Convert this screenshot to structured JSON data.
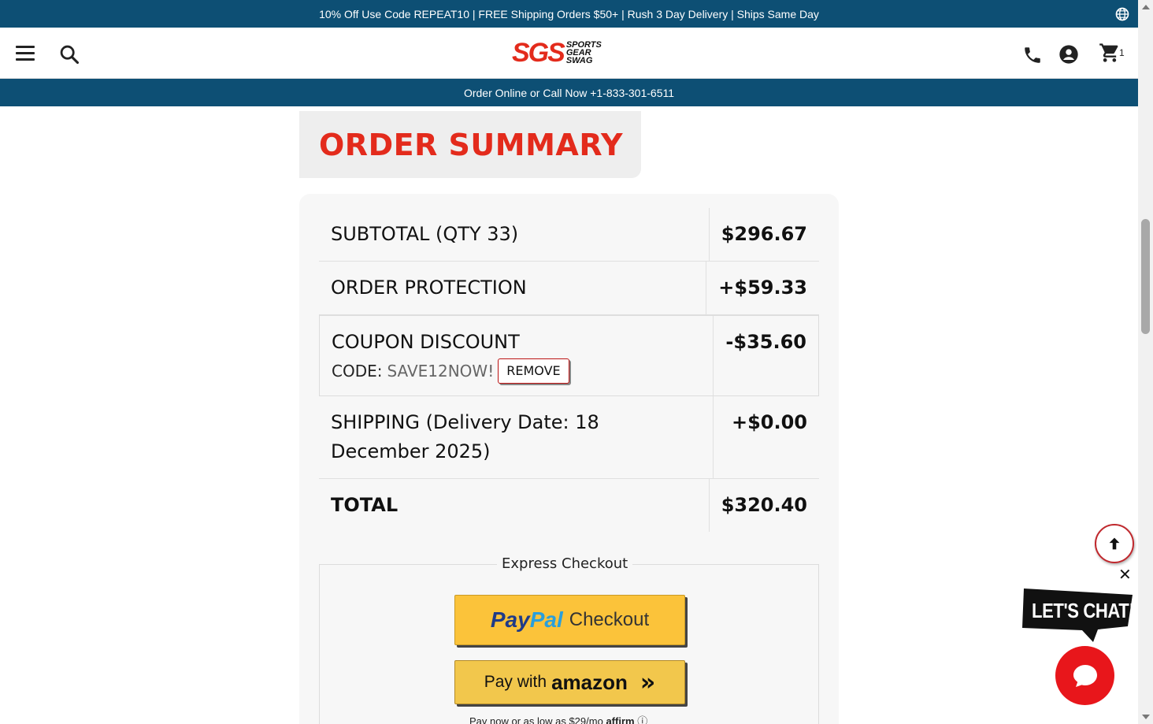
{
  "promo": {
    "text": "10% Off Use Code REPEAT10 | FREE Shipping Orders $50+ | Rush 3 Day Delivery | Ships Same Day"
  },
  "header": {
    "logo_mark": "SGS",
    "logo_words": [
      "SPORTS",
      "GEAR",
      "SWAG"
    ],
    "cart_count": "1"
  },
  "call_bar": {
    "text": "Order Online or Call Now +1-833-301-6511"
  },
  "summary": {
    "title": "ORDER SUMMARY",
    "rows": [
      {
        "label": "SUBTOTAL (QTY 33)",
        "value": "$296.67"
      },
      {
        "label": "ORDER PROTECTION",
        "value": "+$59.33"
      },
      {
        "label": "COUPON DISCOUNT",
        "value": "-$35.60",
        "code_label": "CODE:",
        "code": "SAVE12NOW!",
        "remove_label": "REMOVE"
      },
      {
        "label": "SHIPPING (Delivery Date: 18 December 2025)",
        "value": "+$0.00"
      },
      {
        "label": "TOTAL",
        "value": "$320.40"
      }
    ]
  },
  "express": {
    "title": "Express Checkout",
    "paypal": {
      "pay": "Pay",
      "pal": "Pal",
      "checkout": "Checkout"
    },
    "amazon": {
      "pay_with": "Pay with",
      "brand": "amazon"
    },
    "affirm": {
      "text": "Pay now or as low as $29/mo",
      "brand": "affirm"
    }
  },
  "chat": {
    "label": "LET'S CHAT!"
  },
  "colors": {
    "brand_blue": "#0d4f74",
    "brand_red": "#e32b1c",
    "paypal_yellow": "#fbc33a",
    "amazon_yellow": "#f2c74c"
  },
  "icons": [
    "globe-icon",
    "menu-icon",
    "search-icon",
    "phone-icon",
    "account-icon",
    "cart-icon",
    "arrow-up-icon",
    "close-icon",
    "chat-icon"
  ]
}
